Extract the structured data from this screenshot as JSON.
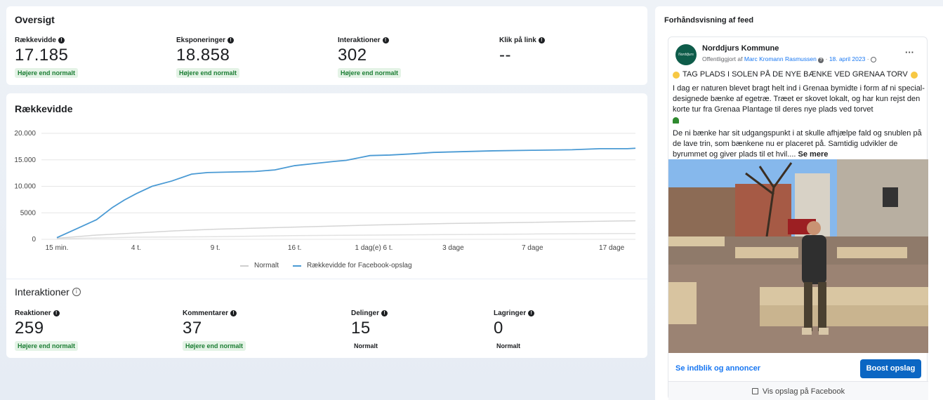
{
  "overview": {
    "title": "Oversigt",
    "metrics": [
      {
        "label": "Rækkevidde",
        "value": "17.185",
        "badge": "Højere end normalt"
      },
      {
        "label": "Eksponeringer",
        "value": "18.858",
        "badge": "Højere end normalt"
      },
      {
        "label": "Interaktioner",
        "value": "302",
        "badge": "Højere end normalt"
      },
      {
        "label": "Klik på link",
        "value": "--",
        "badge": ""
      }
    ]
  },
  "reach_chart": {
    "title": "Rækkevidde",
    "legend_normal": "Normalt",
    "legend_reach": "Rækkevidde for Facebook-opslag"
  },
  "chart_data": {
    "type": "line",
    "title": "Rækkevidde",
    "x": [
      "15 min.",
      "4 t.",
      "9 t.",
      "16 t.",
      "1 dag(e) 6 t.",
      "3 dage",
      "7 dage",
      "17 dage"
    ],
    "y_ticks": [
      "0",
      "5000",
      "10.000",
      "15.000",
      "20.000"
    ],
    "ylim": [
      0,
      20000
    ],
    "grid": true,
    "legend_placement": "bottom",
    "series": [
      {
        "name": "Rækkevidde for Facebook-opslag",
        "color": "#4a9ad4",
        "values": [
          [
            0,
            300
          ],
          [
            0.25,
            2000
          ],
          [
            0.5,
            3700
          ],
          [
            0.7,
            6000
          ],
          [
            0.85,
            7400
          ],
          [
            1.0,
            8600
          ],
          [
            1.2,
            10000
          ],
          [
            1.45,
            11000
          ],
          [
            1.7,
            12300
          ],
          [
            1.9,
            12600
          ],
          [
            2.2,
            12700
          ],
          [
            2.5,
            12800
          ],
          [
            2.75,
            13100
          ],
          [
            3.0,
            13900
          ],
          [
            3.25,
            14300
          ],
          [
            3.5,
            14700
          ],
          [
            3.65,
            14900
          ],
          [
            3.95,
            15800
          ],
          [
            4.2,
            15900
          ],
          [
            4.45,
            16100
          ],
          [
            4.75,
            16400
          ],
          [
            5.0,
            16500
          ],
          [
            5.25,
            16600
          ],
          [
            5.5,
            16700
          ],
          [
            6.0,
            16800
          ],
          [
            6.5,
            16900
          ],
          [
            6.85,
            17100
          ],
          [
            7.2,
            17100
          ],
          [
            7.3,
            17185
          ]
        ]
      },
      {
        "name": "Normalt (øvre)",
        "color": "#d5d5d5",
        "values": [
          [
            0,
            200
          ],
          [
            0.5,
            800
          ],
          [
            1.0,
            1200
          ],
          [
            1.5,
            1600
          ],
          [
            2.0,
            1900
          ],
          [
            3.0,
            2300
          ],
          [
            4.0,
            2700
          ],
          [
            5.0,
            3000
          ],
          [
            6.0,
            3200
          ],
          [
            7.3,
            3500
          ]
        ]
      },
      {
        "name": "Normalt (nedre)",
        "color": "#e2e2e2",
        "values": [
          [
            0,
            100
          ],
          [
            1.0,
            400
          ],
          [
            2.0,
            500
          ],
          [
            3.0,
            700
          ],
          [
            4.0,
            800
          ],
          [
            5.0,
            900
          ],
          [
            6.0,
            1000
          ],
          [
            7.3,
            1100
          ]
        ]
      }
    ]
  },
  "interactions": {
    "title": "Interaktioner",
    "metrics": [
      {
        "label": "Reaktioner",
        "value": "259",
        "badge": "Højere end normalt",
        "type": "up"
      },
      {
        "label": "Kommentarer",
        "value": "37",
        "badge": "Højere end normalt",
        "type": "up"
      },
      {
        "label": "Delinger",
        "value": "15",
        "badge": "Normalt",
        "type": "normal"
      },
      {
        "label": "Lagringer",
        "value": "0",
        "badge": "Normalt",
        "type": "normal"
      }
    ]
  },
  "preview": {
    "title": "Forhåndsvisning af feed",
    "page_name": "Norddjurs Kommune",
    "published_prefix": "Offentliggjort af",
    "author": "Marc Kromann Rasmussen",
    "date": "18. april 2023",
    "more": "···",
    "headline": "TAG PLADS I SOLEN PÅ DE NYE BÆNKE VED GRENAA TORV",
    "para1": "I dag er naturen blevet bragt helt ind i Grenaa bymidte i form af ni special-designede bænke af egetræ. Træet er skovet lokalt, og har kun rejst den korte tur fra Grenaa Plantage til deres nye plads ved torvet",
    "para2": "De ni bænke har sit udgangspunkt i at skulle afhjælpe fald og snublen på de lave trin, som bænkene nu er placeret på. Samtidig udvikler de byrummet og giver plads til et hvil....",
    "see_more": "Se mere",
    "insights_link": "Se indblik og annoncer",
    "boost": "Boost opslag",
    "view_on_fb": "Vis opslag på Facebook"
  }
}
